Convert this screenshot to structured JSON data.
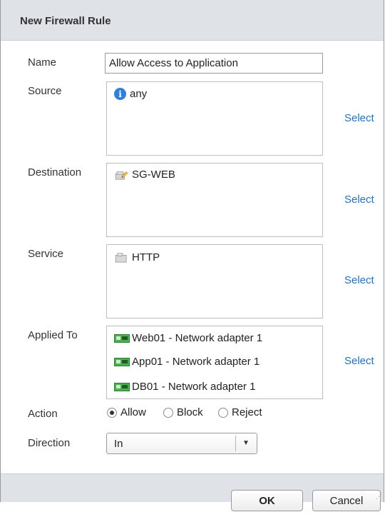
{
  "dialog": {
    "title": "New Firewall Rule"
  },
  "name": {
    "label": "Name",
    "value": "Allow Access to Application"
  },
  "source": {
    "label": "Source",
    "items": [
      "any"
    ],
    "select_label": "Select"
  },
  "destination": {
    "label": "Destination",
    "items": [
      "SG-WEB"
    ],
    "select_label": "Select"
  },
  "service": {
    "label": "Service",
    "items": [
      "HTTP"
    ],
    "select_label": "Select"
  },
  "applied_to": {
    "label": "Applied To",
    "items": [
      "Web01 - Network adapter 1",
      "App01 - Network adapter 1",
      "DB01 - Network adapter 1"
    ],
    "select_label": "Select"
  },
  "action": {
    "label": "Action",
    "options": [
      "Allow",
      "Block",
      "Reject"
    ],
    "selected": "Allow"
  },
  "direction": {
    "label": "Direction",
    "value": "In"
  },
  "buttons": {
    "ok": "OK",
    "cancel": "Cancel"
  },
  "colors": {
    "header_bg": "#dfe3e8",
    "link": "#2a70b0",
    "info_icon": "#2e80d8"
  }
}
